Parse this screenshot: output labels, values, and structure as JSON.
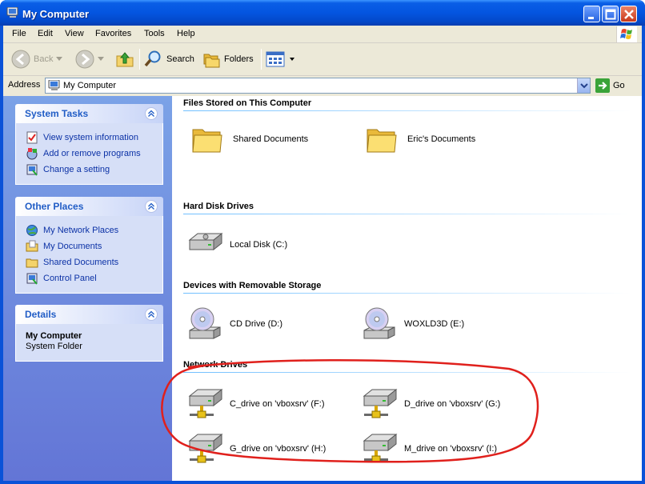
{
  "window": {
    "title": "My Computer"
  },
  "menu": [
    "File",
    "Edit",
    "View",
    "Favorites",
    "Tools",
    "Help"
  ],
  "toolbar": {
    "back": "Back",
    "search": "Search",
    "folders": "Folders"
  },
  "address": {
    "label": "Address",
    "value": "My Computer",
    "go": "Go"
  },
  "system_tasks": {
    "title": "System Tasks",
    "items": [
      "View system information",
      "Add or remove programs",
      "Change a setting"
    ]
  },
  "other_places": {
    "title": "Other Places",
    "items": [
      "My Network Places",
      "My Documents",
      "Shared Documents",
      "Control Panel"
    ]
  },
  "details": {
    "title": "Details",
    "name": "My Computer",
    "type": "System Folder"
  },
  "groups": {
    "files": {
      "title": "Files Stored on This Computer",
      "items": [
        "Shared Documents",
        "Eric's Documents"
      ]
    },
    "hdd": {
      "title": "Hard Disk Drives",
      "items": [
        "Local Disk (C:)"
      ]
    },
    "removable": {
      "title": "Devices with Removable Storage",
      "items": [
        "CD Drive (D:)",
        "WOXLD3D (E:)"
      ]
    },
    "network": {
      "title": "Network Drives",
      "items": [
        "C_drive on 'vboxsrv' (F:)",
        "D_drive on 'vboxsrv' (G:)",
        "G_drive on 'vboxsrv' (H:)",
        "M_drive on 'vboxsrv' (I:)"
      ]
    }
  },
  "icons": {
    "title": "computer-icon",
    "folder": "folder-icon",
    "disk": "hard-disk-icon",
    "cd": "cd-drive-icon",
    "network": "network-drive-icon"
  },
  "colors": {
    "titlebar": "#0a52d8",
    "pane": "#7ba2e7",
    "link": "#0c32a6",
    "annotation": "#e0201c"
  }
}
